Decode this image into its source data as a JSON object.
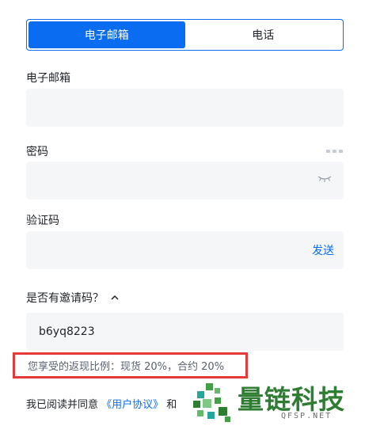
{
  "tabs": [
    {
      "label": "电子邮箱",
      "active": true
    },
    {
      "label": "电话",
      "active": false
    }
  ],
  "email": {
    "label": "电子邮箱",
    "value": "",
    "placeholder": ""
  },
  "password": {
    "label": "密码",
    "value": "",
    "placeholder": ""
  },
  "verify": {
    "label": "验证码",
    "value": "",
    "placeholder": "",
    "send_label": "发送"
  },
  "invite": {
    "toggle_label": "是否有邀请码？",
    "code": "b6yq8223"
  },
  "rebate": {
    "text": "您享受的返现比例：现货 20%，合约 20%"
  },
  "agreement": {
    "prefix": "我已阅读并同意 ",
    "link": "《用户协议》",
    "suffix": " 和"
  },
  "watermark": {
    "brand": "量链科技",
    "site": "QFSP.NET"
  },
  "colors": {
    "accent": "#0a6cf0",
    "highlight_border": "#e53a3a",
    "watermark_green": "#2e7d32"
  }
}
